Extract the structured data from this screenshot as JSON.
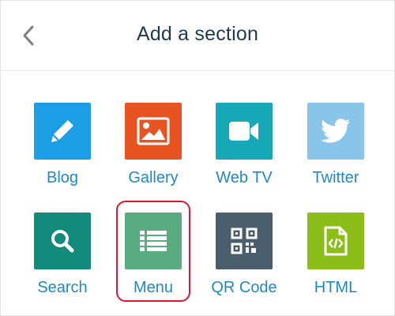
{
  "header": {
    "title": "Add a section",
    "back_icon": "chevron-left-icon"
  },
  "sections": [
    {
      "label": "Blog",
      "icon": "pencil-icon",
      "color": "#1b9ee5"
    },
    {
      "label": "Gallery",
      "icon": "image-icon",
      "color": "#e85322"
    },
    {
      "label": "Web TV",
      "icon": "video-camera-icon",
      "color": "#17a8b8"
    },
    {
      "label": "Twitter",
      "icon": "twitter-icon",
      "color": "#89c4e9"
    },
    {
      "label": "Search",
      "icon": "magnifier-icon",
      "color": "#128a7c"
    },
    {
      "label": "Menu",
      "icon": "list-icon",
      "color": "#5aac80"
    },
    {
      "label": "QR Code",
      "icon": "qr-code-icon",
      "color": "#4a5e6b"
    },
    {
      "label": "HTML",
      "icon": "code-file-icon",
      "color": "#8cbe1a"
    }
  ],
  "highlight_color": "#e0142c"
}
